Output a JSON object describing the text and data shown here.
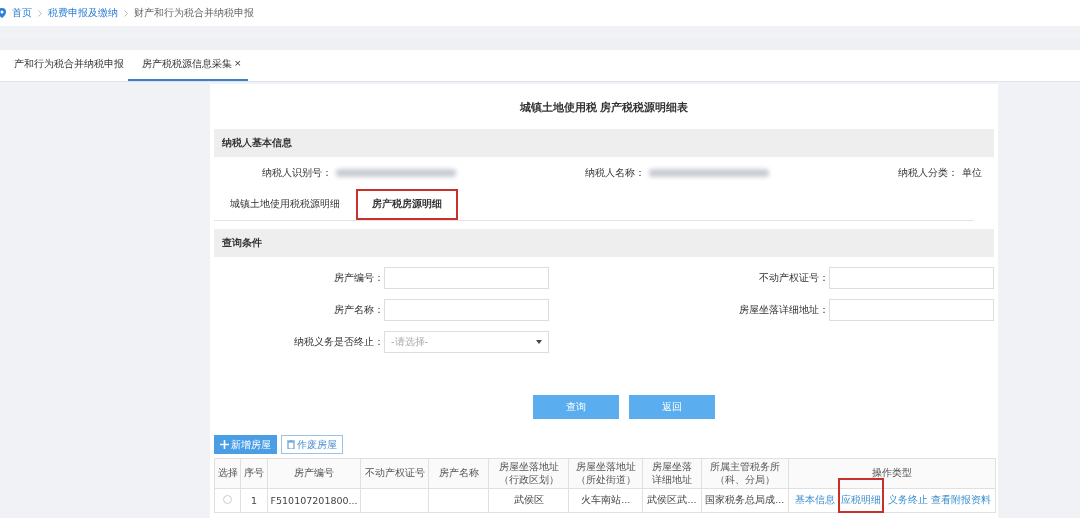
{
  "breadcrumb": [
    {
      "label": "首页",
      "link": true
    },
    {
      "label": "税费申报及缴纳",
      "link": true
    },
    {
      "label": "财产和行为税合并纳税申报",
      "link": false
    }
  ],
  "top_tabs": [
    {
      "label": "产和行为税合并纳税申报",
      "selected": false
    },
    {
      "label": "房产税税源信息采集",
      "selected": true,
      "close": "×"
    }
  ],
  "title": "城镇土地使用税  房产税税源明细表",
  "taxpayer_section": {
    "heading": "纳税人基本信息",
    "fields": [
      {
        "label": "纳税人识别号：",
        "kind": "blurred"
      },
      {
        "label": "纳税人名称：",
        "kind": "blurred"
      },
      {
        "label": "纳税人分类：",
        "kind": "text",
        "value": "单位"
      }
    ]
  },
  "sub_tabs": [
    {
      "label": "城镇土地使用税税源明细",
      "selected": false,
      "highlighted": false
    },
    {
      "label": "房产税房源明细",
      "selected": true,
      "highlighted": true
    }
  ],
  "query_section": {
    "heading": "查询条件",
    "fields": [
      {
        "label": "房产编号：",
        "kind": "input"
      },
      {
        "label": "不动产权证号：",
        "kind": "input"
      },
      {
        "label": "房产名称：",
        "kind": "input"
      },
      {
        "label": "房屋坐落详细地址：",
        "kind": "input"
      },
      {
        "label": "纳税义务是否终止：",
        "kind": "select",
        "placeholder": "-请选择-"
      }
    ]
  },
  "actions": [
    "查询",
    "返回"
  ],
  "toolbar": [
    {
      "label": "新增房屋",
      "kind": "primary"
    },
    {
      "label": "作废房屋",
      "kind": "outline"
    }
  ],
  "table": {
    "columns": [
      "选择",
      "序号",
      "房产编号",
      "不动产权证号",
      "房产名称",
      "房屋坐落地址（行政区划）",
      "房屋坐落地址（所处街道）",
      "房屋坐落详细地址",
      "所属主管税务所（科、分局）",
      "操作类型"
    ],
    "rows": [
      {
        "selected": false,
        "cells": [
          "",
          "1",
          "F510107201800...",
          "",
          "",
          "武侯区",
          "火车南站...",
          "武侯区武...",
          "国家税务总局成..."
        ],
        "operations": [
          {
            "label": "基本信息",
            "highlighted": false
          },
          {
            "label": "应税明细",
            "highlighted": true
          },
          {
            "label": "义务终止",
            "highlighted": false
          },
          {
            "label": "查看附报资料",
            "highlighted": false
          }
        ]
      }
    ]
  }
}
